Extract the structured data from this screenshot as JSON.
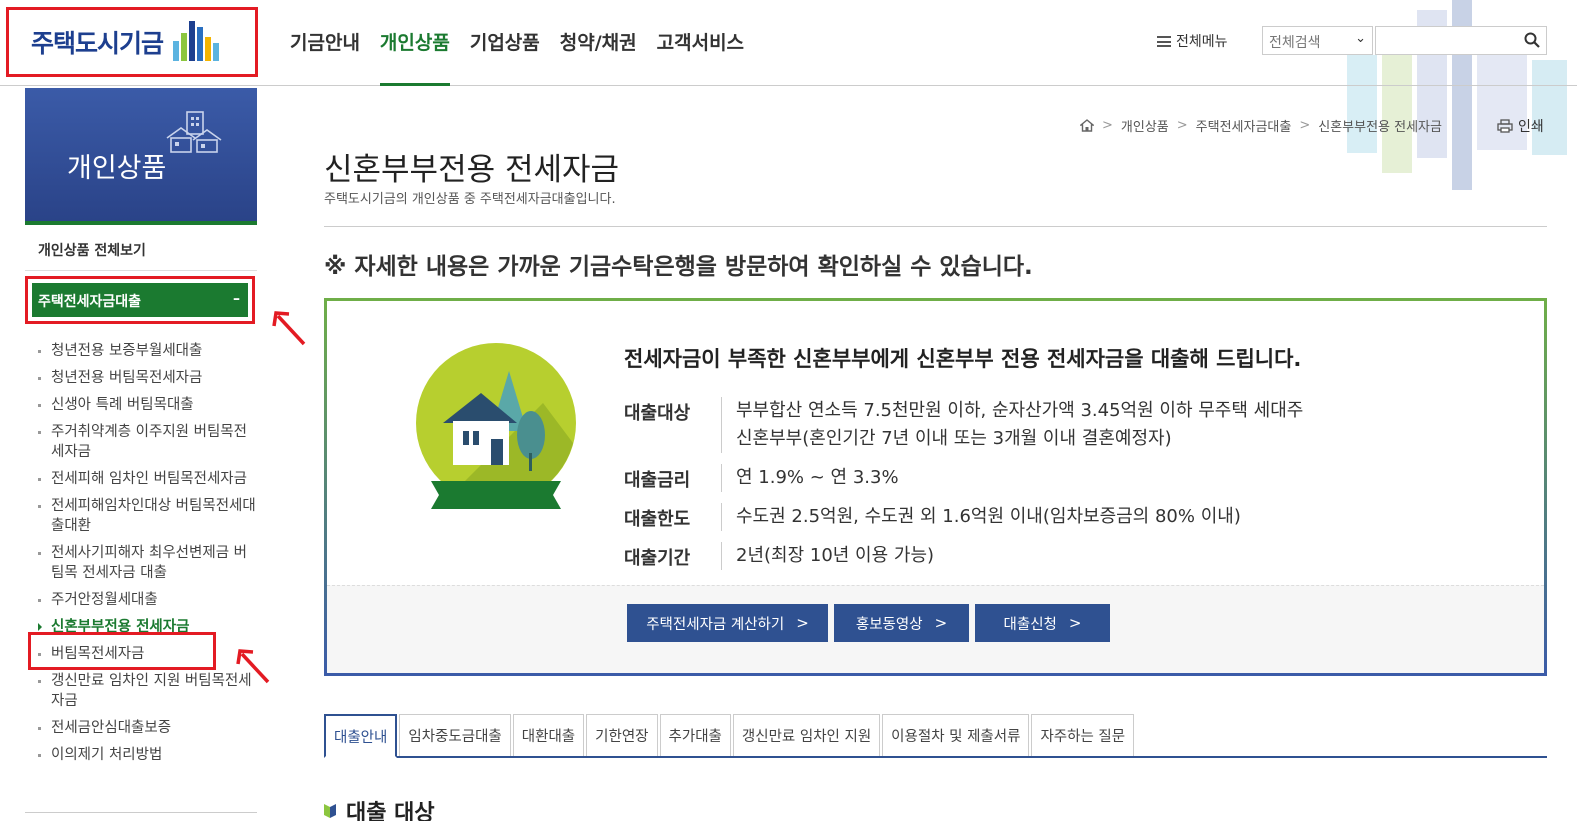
{
  "header": {
    "logo_text": "주택도시기금",
    "nav": [
      "기금안내",
      "개인상품",
      "기업상품",
      "청약/채권",
      "고객서비스"
    ],
    "active_nav": "개인상품",
    "all_menu": "전체메뉴",
    "search_scope": "전체검색",
    "search_placeholder": ""
  },
  "sidebar": {
    "banner_title": "개인상품",
    "view_all": "개인상품 전체보기",
    "active_group": "주택전세자금대출",
    "active_group_toggle": "–",
    "items": [
      "청년전용 보증부월세대출",
      "청년전용 버팀목전세자금",
      "신생아 특례 버팀목대출",
      "주거취약계층 이주지원 버팀목전세자금",
      "전세피해 임차인 버팀목전세자금",
      "전세피해임차인대상 버팀목전세대출대환",
      "전세사기피해자 최우선변제금 버팀목 전세자금 대출",
      "주거안정월세대출",
      "신혼부부전용 전세자금",
      "버팀목전세자금",
      "갱신만료 임차인 지원 버팀목전세자금",
      "전세금안심대출보증",
      "이의제기 처리방법"
    ],
    "current_index": 8
  },
  "breadcrumb": {
    "items": [
      "개인상품",
      "주택전세자금대출",
      "신혼부부전용 전세자금"
    ],
    "print": "인쇄"
  },
  "main": {
    "title": "신혼부부전용 전세자금",
    "description": "주택도시기금의 개인상품 중 주택전세자금대출입니다.",
    "notice": "※ 자세한 내용은 가까운 기금수탁은행을 방문하여 확인하실 수 있습니다.",
    "badge_label": "신혼부부전용 전세자금",
    "info_headline": "전세자금이 부족한 신혼부부에게 신혼부부 전용 전세자금을 대출해 드립니다.",
    "info": [
      {
        "key": "대출대상",
        "value": "부부합산 연소득 7.5천만원 이하, 순자산가액 3.45억원 이하 무주택 세대주",
        "value2": "신혼부부(혼인기간 7년 이내 또는 3개월 이내 결혼예정자)"
      },
      {
        "key": "대출금리",
        "value": "연 1.9% ~ 연 3.3%",
        "value2": ""
      },
      {
        "key": "대출한도",
        "value": "수도권 2.5억원, 수도권 외 1.6억원 이내(임차보증금의 80% 이내)",
        "value2": ""
      },
      {
        "key": "대출기간",
        "value": "2년(최장 10년 이용 가능)",
        "value2": ""
      }
    ],
    "buttons": [
      "주택전세자금 계산하기",
      "홍보동영상",
      "대출신청"
    ],
    "tabs": [
      "대출안내",
      "임차중도금대출",
      "대환대출",
      "기한연장",
      "추가대출",
      "갱신만료 임차인 지원",
      "이용절차 및 제출서류",
      "자주하는 질문"
    ],
    "active_tab": 0,
    "section_title": "대출 대상"
  },
  "colors": {
    "brand_blue": "#2f5191",
    "brand_green": "#1b7a30",
    "highlight_red": "#e31b23"
  }
}
